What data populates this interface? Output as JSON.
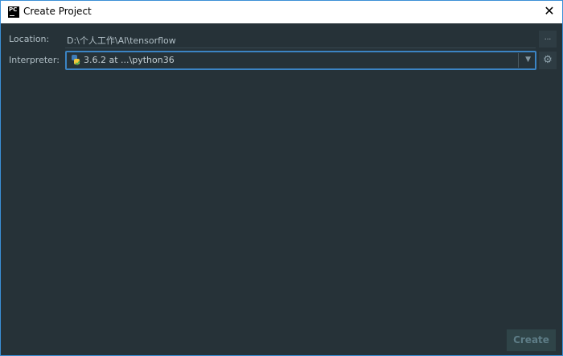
{
  "window": {
    "title": "Create Project",
    "app_icon_text": "PC"
  },
  "form": {
    "location_label": "Location:",
    "location_value": "D:\\个人工作\\AI\\tensorflow",
    "browse_label": "...",
    "interpreter_label": "Interpreter:",
    "interpreter_value": "3.6.2 at ...\\python36"
  },
  "footer": {
    "create_label": "Create"
  },
  "colors": {
    "background": "#263238",
    "focus": "#3b84c4"
  }
}
